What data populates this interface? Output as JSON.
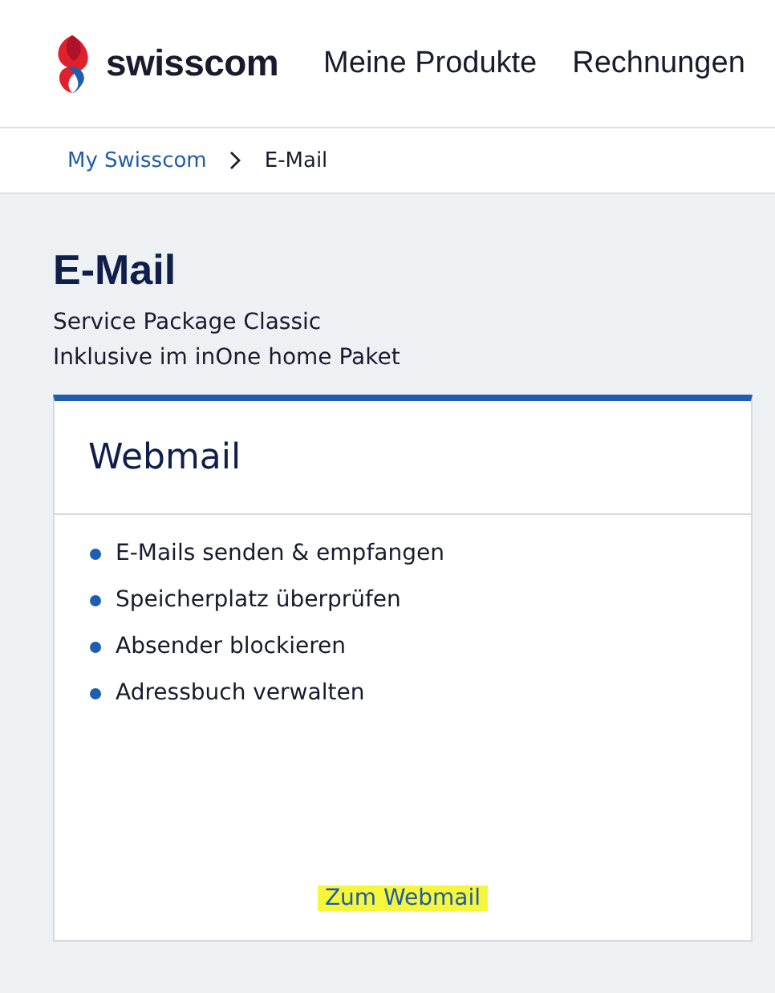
{
  "header": {
    "brand": "swisscom",
    "nav": [
      {
        "label": "Meine Produkte"
      },
      {
        "label": "Rechnungen"
      }
    ]
  },
  "breadcrumb": [
    {
      "label": "My Swisscom",
      "kind": "link"
    },
    {
      "label": "E-Mail",
      "kind": "current"
    }
  ],
  "page": {
    "title": "E-Mail",
    "subtitles": [
      "Service Package Classic",
      "Inklusive im inOne home Paket"
    ]
  },
  "card": {
    "title": "Webmail",
    "features": [
      "E-Mails senden & empfangen",
      "Speicherplatz überprüfen",
      "Absender blockieren",
      "Adressbuch verwalten"
    ],
    "link": {
      "label": "Zum Webmail",
      "highlighted": true
    }
  }
}
